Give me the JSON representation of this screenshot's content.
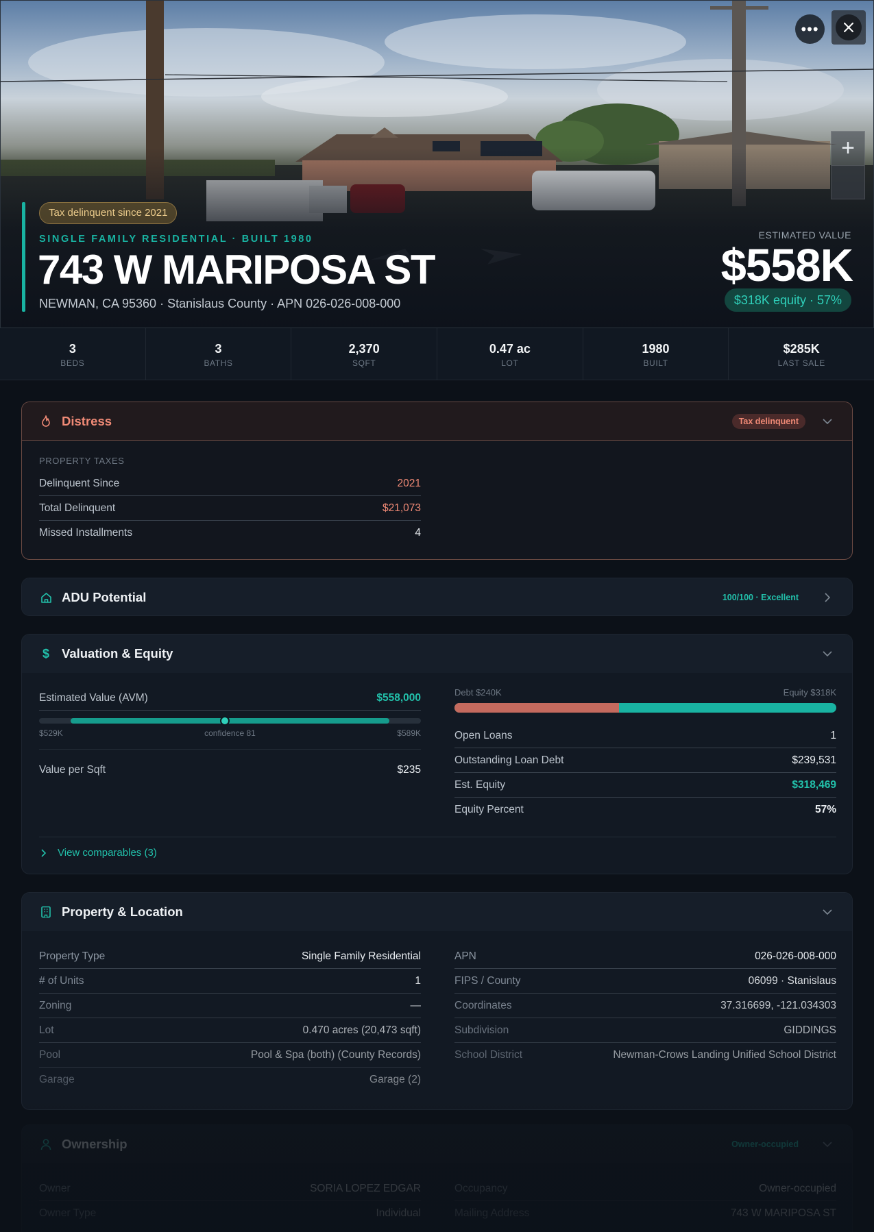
{
  "hero": {
    "badge": "Tax delinquent since 2021",
    "subtitle": "SINGLE FAMILY RESIDENTIAL · BUILT 1980",
    "address": "743 W MARIPOSA ST",
    "location": "NEWMAN, CA 95360 · Stanislaus County · APN 026-026-008-000",
    "estimated_value_label": "ESTIMATED VALUE",
    "estimated_value": "$558K",
    "equity_pill": "$318K equity · 57%",
    "more_icon": "more-horizontal-icon",
    "close_icon": "close-icon",
    "zoom_in_label": "+"
  },
  "stats": [
    {
      "value": "3",
      "label": "BEDS"
    },
    {
      "value": "3",
      "label": "BATHS"
    },
    {
      "value": "2,370",
      "label": "SQFT"
    },
    {
      "value": "0.47 ac",
      "label": "LOT"
    },
    {
      "value": "1980",
      "label": "BUILT"
    },
    {
      "value": "$285K",
      "label": "LAST SALE"
    }
  ],
  "distress": {
    "title": "Distress",
    "pill": "Tax delinquent",
    "section": "PROPERTY TAXES",
    "rows": [
      {
        "k": "Delinquent Since",
        "v": "2021"
      },
      {
        "k": "Total Delinquent",
        "v": "$21,073"
      },
      {
        "k": "Missed Installments",
        "v": "4"
      }
    ]
  },
  "adu": {
    "title": "ADU Potential",
    "score": "100/100 · Excellent"
  },
  "valuation": {
    "title": "Valuation & Equity",
    "avm_label": "Estimated Value (AVM)",
    "avm_value": "$558,000",
    "range_low": "$529K",
    "confidence": "confidence 81",
    "range_high": "$589K",
    "avm_low_value": 529,
    "avm_high_value": 589,
    "avm_mid_value": 558,
    "value_per_sqft_label": "Value per Sqft",
    "value_per_sqft": "$235",
    "debt_label": "Debt $240K",
    "equity_label": "Equity $318K",
    "debt_fraction": 0.43,
    "rows": [
      {
        "k": "Open Loans",
        "v": "1"
      },
      {
        "k": "Outstanding Loan Debt",
        "v": "$239,531"
      },
      {
        "k": "Est. Equity",
        "v": "$318,469"
      },
      {
        "k": "Equity Percent",
        "v": "57%"
      }
    ],
    "comparables": "View comparables (3)"
  },
  "property": {
    "title": "Property & Location",
    "left": [
      {
        "k": "Property Type",
        "v": "Single Family Residential"
      },
      {
        "k": "# of Units",
        "v": "1"
      },
      {
        "k": "Zoning",
        "v": "—"
      },
      {
        "k": "Lot",
        "v": "0.470 acres (20,473 sqft)"
      },
      {
        "k": "Pool",
        "v": "Pool & Spa (both) (County Records)"
      },
      {
        "k": "Garage",
        "v": "Garage (2)"
      }
    ],
    "right": [
      {
        "k": "APN",
        "v": "026-026-008-000"
      },
      {
        "k": "FIPS / County",
        "v": "06099 · Stanislaus"
      },
      {
        "k": "Coordinates",
        "v": "37.316699, -121.034303"
      },
      {
        "k": "Subdivision",
        "v": "GIDDINGS"
      },
      {
        "k": "School District",
        "v": "Newman-Crows Landing Unified School District"
      }
    ]
  },
  "ownership": {
    "title": "Ownership",
    "pill": "Owner-occupied",
    "left": [
      {
        "k": "Owner",
        "v": "SORIA LOPEZ EDGAR"
      },
      {
        "k": "Owner Type",
        "v": "Individual"
      }
    ],
    "right": [
      {
        "k": "Occupancy",
        "v": "Owner-occupied"
      },
      {
        "k": "Mailing Address",
        "v": "743 W MARIPOSA ST"
      }
    ]
  },
  "colors": {
    "accent": "#19b3a2",
    "debt": "#c46a5e",
    "distress": "#f08a76"
  }
}
